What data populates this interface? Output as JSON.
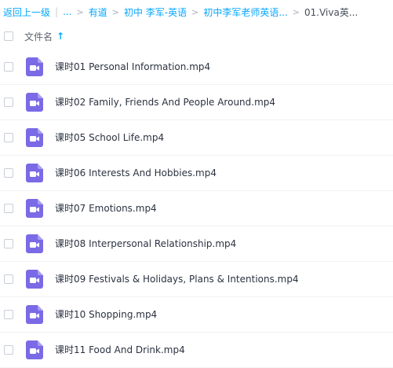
{
  "breadcrumb": {
    "back": "返回上一级",
    "ellipsis": "...",
    "items": [
      "有道",
      "初中 李军-英语",
      "初中李军老师英语..."
    ],
    "current": "01.Viva英..."
  },
  "header": {
    "column_label": "文件名"
  },
  "colors": {
    "accent": "#06a7ff",
    "video_icon": "#7a6ae6"
  },
  "files": [
    {
      "name": "课时01 Personal Information.mp4",
      "icon": "video-file-icon"
    },
    {
      "name": "课时02 Family, Friends And People Around.mp4",
      "icon": "video-file-icon"
    },
    {
      "name": "课时05 School Life.mp4",
      "icon": "video-file-icon"
    },
    {
      "name": "课时06 Interests And Hobbies.mp4",
      "icon": "video-file-icon"
    },
    {
      "name": "课时07 Emotions.mp4",
      "icon": "video-file-icon"
    },
    {
      "name": "课时08 Interpersonal Relationship.mp4",
      "icon": "video-file-icon"
    },
    {
      "name": "课时09 Festivals & Holidays, Plans & Intentions.mp4",
      "icon": "video-file-icon"
    },
    {
      "name": "课时10 Shopping.mp4",
      "icon": "video-file-icon"
    },
    {
      "name": "课时11 Food And Drink.mp4",
      "icon": "video-file-icon"
    }
  ]
}
